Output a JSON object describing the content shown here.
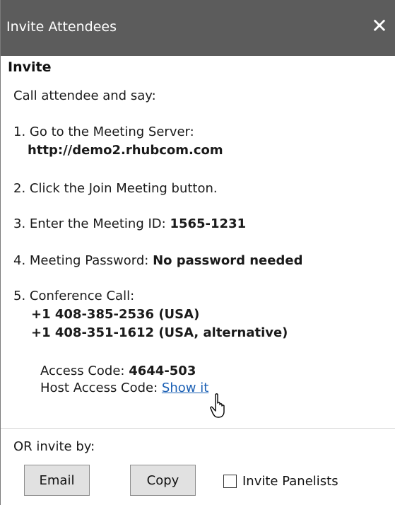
{
  "window": {
    "title": "Invite Attendees",
    "close_glyph": "✕"
  },
  "invite": {
    "heading": "Invite",
    "intro": "Call attendee and say:",
    "step1_label": "1. Go to the Meeting Server:",
    "step1_value": "http://demo2.rhubcom.com",
    "step2": "2. Click the Join Meeting button.",
    "step3_label": "3. Enter the Meeting ID: ",
    "step3_value": "1565-1231",
    "step4_label": "4. Meeting Password: ",
    "step4_value": "No password needed",
    "step5_label": "5. Conference Call:",
    "phone1": "+1 408-385-2536 (USA)",
    "phone2": "+1 408-351-1612 (USA, alternative)",
    "access_label": "Access Code: ",
    "access_value": "4644-503",
    "host_access_label": "Host Access Code: ",
    "host_access_link": "Show it"
  },
  "footer": {
    "or_invite": "OR invite by:",
    "email_button": "Email",
    "copy_button": "Copy",
    "invite_panelists": "Invite Panelists",
    "invite_panelists_checked": false
  },
  "colors": {
    "titlebar": "#5c5c5c",
    "link": "#1a5fb4",
    "button": "#e1e1e1"
  },
  "icons": {
    "close": "close-icon",
    "cursor": "hand-cursor-icon"
  }
}
